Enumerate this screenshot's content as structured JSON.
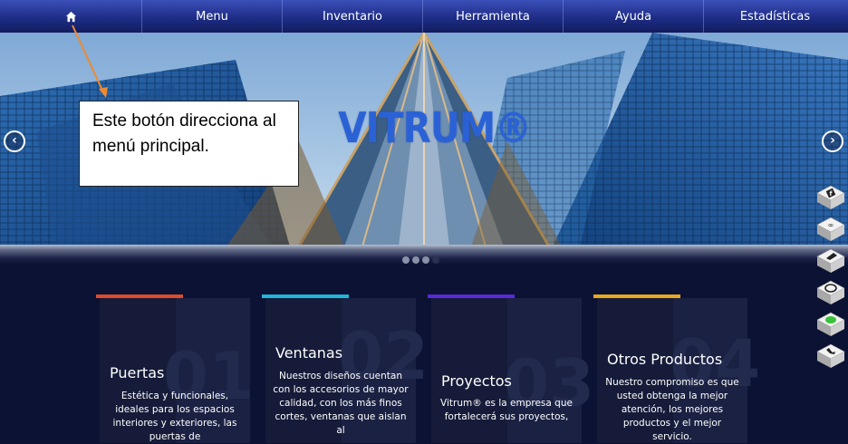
{
  "nav": {
    "home_icon": "home-icon",
    "items": [
      {
        "label": "Menu"
      },
      {
        "label": "Inventario"
      },
      {
        "label": "Herramienta"
      },
      {
        "label": "Ayuda"
      },
      {
        "label": "Estadísticas"
      }
    ]
  },
  "slider": {
    "title": "VITRUM®",
    "prev_icon": "chevron-left-icon",
    "next_icon": "chevron-right-icon",
    "slide_count": 4,
    "active_slide": 1
  },
  "callout": {
    "text": "Este botón direcciona al menú principal."
  },
  "side_icons": [
    "facebook-icon",
    "hangouts-icon",
    "flipboard-icon",
    "skype-icon",
    "line-icon",
    "phone-icon"
  ],
  "cards": [
    {
      "number": "01",
      "title": "Puertas",
      "text": "Estética y funcionales, ideales para los espacios interiores y exteriores, las puertas de",
      "accent": "#e04a2a"
    },
    {
      "number": "02",
      "title": "Ventanas",
      "text": "Nuestros diseños cuentan con los accesorios de mayor calidad, con los más finos cortes, ventanas que aislan al",
      "accent": "#1fb6d8"
    },
    {
      "number": "03",
      "title": "Proyectos",
      "text": "Vitrum® es la empresa que fortalecerá sus proyectos,",
      "accent": "#5a2ad8"
    },
    {
      "number": "04",
      "title": "Otros Productos",
      "text": "Nuestro compromiso es que usted obtenga la mejor atención, los mejores productos y el mejor servicio.",
      "accent": "#e8a81e"
    }
  ],
  "colors": {
    "nav_top": "#3b4fb8",
    "nav_bottom": "#121c5c",
    "page_background": "#0b1233",
    "title_blue": "#2a62d6",
    "callout_arrow": "#f08a30"
  }
}
